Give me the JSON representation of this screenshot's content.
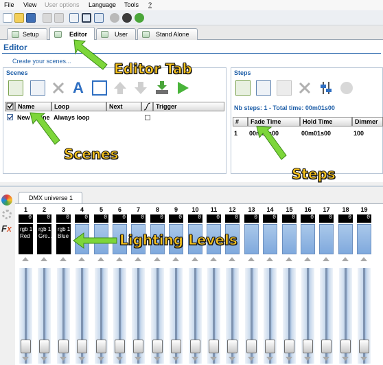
{
  "menu": {
    "items": [
      {
        "label": "File",
        "disabled": false
      },
      {
        "label": "View",
        "disabled": false
      },
      {
        "label": "User options",
        "disabled": true
      },
      {
        "label": "Language",
        "disabled": false
      },
      {
        "label": "Tools",
        "disabled": false
      },
      {
        "label": "?",
        "disabled": false
      }
    ]
  },
  "toolbar": {
    "icons": [
      "new-file-icon",
      "open-folder-icon",
      "save-icon",
      "undo-icon",
      "redo-icon",
      "grid-view-icon",
      "chart-view-icon",
      "window-icon",
      "tools-icon",
      "play-icon",
      "help-icon"
    ]
  },
  "tabs": [
    {
      "label": "Setup",
      "active": false
    },
    {
      "label": "Editor",
      "active": true
    },
    {
      "label": "User",
      "active": false
    },
    {
      "label": "Stand Alone",
      "active": false
    }
  ],
  "editor": {
    "title": "Editor",
    "hint": "Create your scenes..."
  },
  "scenes": {
    "title": "Scenes",
    "toolbar_icons": [
      "add-scene-icon",
      "edit-scene-icon",
      "delete-icon",
      "rename-icon",
      "checklist-icon",
      "move-up-icon",
      "move-down-icon",
      "download-icon",
      "play-icon"
    ],
    "columns": [
      "Name",
      "Loop",
      "Next",
      "Trigger"
    ],
    "rows": [
      {
        "checked": true,
        "name": "New Scene",
        "loop": "Always loop",
        "next": "",
        "trigger": false
      }
    ]
  },
  "steps": {
    "title": "Steps",
    "summary": "Nb steps: 1 - Total time: 00m01s00",
    "toolbar_icons": [
      "add-step-icon",
      "copy-step-icon",
      "paste-step-icon",
      "delete-icon",
      "sliders-icon",
      "stop-icon"
    ],
    "columns": [
      "#",
      "Fade Time",
      "Hold Time",
      "Dimmer"
    ],
    "rows": [
      {
        "index": "1",
        "fade": "00m00s00",
        "hold": "00m01s00",
        "dimmer": "100"
      }
    ]
  },
  "dmx": {
    "tab_label": "DMX universe 1",
    "side_icons": [
      "color-palette-icon",
      "gear-icon",
      "fx-icon"
    ],
    "channels": [
      {
        "num": "1",
        "value": "0",
        "label1": "rgb 1",
        "label2": "Red"
      },
      {
        "num": "2",
        "value": "0",
        "label1": "rgb 1",
        "label2": "Gre..."
      },
      {
        "num": "3",
        "value": "0",
        "label1": "rgb 1",
        "label2": "Blue"
      },
      {
        "num": "4",
        "value": "0",
        "label1": "",
        "label2": ""
      },
      {
        "num": "5",
        "value": "0",
        "label1": "",
        "label2": ""
      },
      {
        "num": "6",
        "value": "0",
        "label1": "",
        "label2": ""
      },
      {
        "num": "7",
        "value": "0",
        "label1": "",
        "label2": ""
      },
      {
        "num": "8",
        "value": "0",
        "label1": "",
        "label2": ""
      },
      {
        "num": "9",
        "value": "0",
        "label1": "",
        "label2": ""
      },
      {
        "num": "10",
        "value": "0",
        "label1": "",
        "label2": ""
      },
      {
        "num": "11",
        "value": "0",
        "label1": "",
        "label2": ""
      },
      {
        "num": "12",
        "value": "0",
        "label1": "",
        "label2": ""
      },
      {
        "num": "13",
        "value": "0",
        "label1": "",
        "label2": ""
      },
      {
        "num": "14",
        "value": "0",
        "label1": "",
        "label2": ""
      },
      {
        "num": "15",
        "value": "0",
        "label1": "",
        "label2": ""
      },
      {
        "num": "16",
        "value": "0",
        "label1": "",
        "label2": ""
      },
      {
        "num": "17",
        "value": "0",
        "label1": "",
        "label2": ""
      },
      {
        "num": "18",
        "value": "0",
        "label1": "",
        "label2": ""
      },
      {
        "num": "19",
        "value": "0",
        "label1": "",
        "label2": ""
      }
    ]
  },
  "annotations": {
    "editor_tab": "Editor Tab",
    "scenes": "Scenes",
    "steps": "Steps",
    "lighting_levels": "Lighting Levels"
  },
  "colors": {
    "accent_blue": "#1f5fa8",
    "annotation_yellow": "#f7c21a",
    "arrow_green": "#7dd63a"
  }
}
